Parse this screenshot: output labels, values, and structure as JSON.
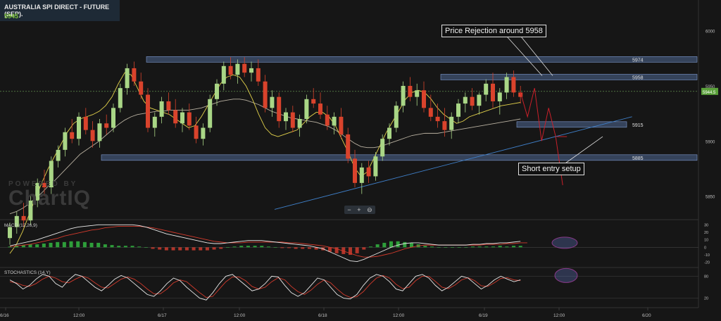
{
  "header": {
    "title": "AUSTRALIA SPI DIRECT - FUTURE (SEP).",
    "price": "5945"
  },
  "watermark": {
    "line1": "POWERED BY",
    "line2": "ChartIQ"
  },
  "zoom_controls": {
    "minus": "−",
    "plus": "+",
    "magnify": "⊖"
  },
  "callouts": {
    "rejection": "Price Rejection around 5958",
    "short": "Short entry setup"
  },
  "colors": {
    "up": "#a9d686",
    "down": "#d9432c",
    "zone": "#5a7bb0",
    "fast_ma": "#e3d24b",
    "slow_ma": "#b8b0a0",
    "trend": "#3f7fc8",
    "projection": "#c9202a",
    "highlight": "#5b6fb8"
  },
  "chart_data": [
    {
      "type": "candlestick",
      "title": "AUSTRALIA SPI DIRECT - FUTURE (SEP).",
      "last_price": 5945,
      "ylim": [
        5830,
        6010
      ],
      "y_ticks": [
        6000,
        5950,
        5900,
        5850
      ],
      "x_labels": [
        "6/16",
        "12:00",
        "6/17",
        "12:00",
        "6/18",
        "12:00",
        "6/19",
        "12:00",
        "6/20"
      ],
      "levels": [
        {
          "label": "5974",
          "value": 5974
        },
        {
          "label": "5958",
          "value": 5958
        },
        {
          "label": "5915",
          "value": 5915
        },
        {
          "label": "5885",
          "value": 5885
        }
      ],
      "current_label": "5944.5",
      "moving_average_fast": [
        5798,
        5806,
        5818,
        5833,
        5848,
        5862,
        5875,
        5886,
        5897,
        5908,
        5916,
        5920,
        5922,
        5924,
        5927,
        5932,
        5940,
        5952,
        5962,
        5960,
        5948,
        5936,
        5930,
        5928,
        5926,
        5924,
        5920,
        5916,
        5912,
        5914,
        5922,
        5932,
        5942,
        5952,
        5958,
        5960,
        5958,
        5950,
        5938,
        5924,
        5912,
        5906,
        5904,
        5906,
        5908,
        5910,
        5916,
        5922,
        5926,
        5926,
        5922,
        5914,
        5902,
        5890,
        5876,
        5868,
        5872,
        5884,
        5896,
        5908,
        5918,
        5928,
        5938,
        5944,
        5946,
        5944,
        5938,
        5930,
        5924,
        5920,
        5916,
        5918,
        5922,
        5924,
        5926,
        5928,
        5930,
        5932,
        5933,
        5934,
        5935
      ],
      "moving_average_slow": [
        5834,
        5836,
        5839,
        5843,
        5848,
        5853,
        5859,
        5864,
        5870,
        5876,
        5882,
        5888,
        5892,
        5896,
        5900,
        5905,
        5910,
        5915,
        5919,
        5922,
        5924,
        5925,
        5926,
        5927,
        5927,
        5928,
        5928,
        5928,
        5928,
        5929,
        5930,
        5932,
        5934,
        5936,
        5937,
        5938,
        5938,
        5937,
        5935,
        5933,
        5930,
        5927,
        5925,
        5923,
        5921,
        5920,
        5919,
        5918,
        5917,
        5915,
        5913,
        5910,
        5906,
        5902,
        5898,
        5895,
        5894,
        5894,
        5895,
        5897,
        5899,
        5901,
        5903,
        5905,
        5906,
        5907,
        5907,
        5907,
        5908,
        5909,
        5910,
        5911,
        5912,
        5913,
        5914,
        5915,
        5916,
        5917,
        5918,
        5919,
        5920
      ],
      "candles_ohlc": [
        [
          5812,
          5826,
          5806,
          5822
        ],
        [
          5822,
          5836,
          5816,
          5832
        ],
        [
          5832,
          5844,
          5822,
          5828
        ],
        [
          5828,
          5850,
          5824,
          5846
        ],
        [
          5846,
          5866,
          5840,
          5862
        ],
        [
          5862,
          5874,
          5850,
          5858
        ],
        [
          5858,
          5886,
          5852,
          5882
        ],
        [
          5882,
          5896,
          5876,
          5892
        ],
        [
          5892,
          5912,
          5886,
          5908
        ],
        [
          5908,
          5920,
          5898,
          5902
        ],
        [
          5902,
          5926,
          5896,
          5922
        ],
        [
          5922,
          5930,
          5906,
          5910
        ],
        [
          5910,
          5918,
          5894,
          5900
        ],
        [
          5900,
          5920,
          5894,
          5916
        ],
        [
          5916,
          5924,
          5906,
          5912
        ],
        [
          5912,
          5934,
          5908,
          5930
        ],
        [
          5930,
          5952,
          5926,
          5948
        ],
        [
          5948,
          5970,
          5942,
          5966
        ],
        [
          5966,
          5972,
          5950,
          5954
        ],
        [
          5954,
          5962,
          5938,
          5942
        ],
        [
          5942,
          5948,
          5908,
          5912
        ],
        [
          5912,
          5926,
          5904,
          5922
        ],
        [
          5922,
          5940,
          5916,
          5936
        ],
        [
          5936,
          5944,
          5924,
          5928
        ],
        [
          5928,
          5938,
          5912,
          5916
        ],
        [
          5916,
          5930,
          5908,
          5926
        ],
        [
          5926,
          5934,
          5910,
          5914
        ],
        [
          5914,
          5922,
          5898,
          5902
        ],
        [
          5902,
          5916,
          5896,
          5912
        ],
        [
          5912,
          5942,
          5908,
          5938
        ],
        [
          5938,
          5956,
          5932,
          5952
        ],
        [
          5952,
          5972,
          5946,
          5968
        ],
        [
          5968,
          5976,
          5956,
          5960
        ],
        [
          5960,
          5974,
          5952,
          5970
        ],
        [
          5970,
          5976,
          5958,
          5962
        ],
        [
          5962,
          5972,
          5954,
          5966
        ],
        [
          5966,
          5974,
          5950,
          5954
        ],
        [
          5954,
          5960,
          5926,
          5930
        ],
        [
          5930,
          5946,
          5922,
          5940
        ],
        [
          5940,
          5944,
          5912,
          5918
        ],
        [
          5918,
          5930,
          5910,
          5926
        ],
        [
          5926,
          5932,
          5908,
          5912
        ],
        [
          5912,
          5924,
          5904,
          5920
        ],
        [
          5920,
          5942,
          5916,
          5938
        ],
        [
          5938,
          5948,
          5930,
          5934
        ],
        [
          5934,
          5944,
          5920,
          5924
        ],
        [
          5924,
          5932,
          5910,
          5914
        ],
        [
          5914,
          5926,
          5906,
          5922
        ],
        [
          5922,
          5930,
          5902,
          5906
        ],
        [
          5906,
          5912,
          5880,
          5884
        ],
        [
          5884,
          5892,
          5858,
          5862
        ],
        [
          5862,
          5880,
          5852,
          5876
        ],
        [
          5876,
          5882,
          5862,
          5868
        ],
        [
          5868,
          5890,
          5864,
          5886
        ],
        [
          5886,
          5906,
          5882,
          5902
        ],
        [
          5902,
          5916,
          5896,
          5912
        ],
        [
          5912,
          5936,
          5908,
          5932
        ],
        [
          5932,
          5954,
          5926,
          5950
        ],
        [
          5950,
          5958,
          5936,
          5940
        ],
        [
          5940,
          5952,
          5932,
          5946
        ],
        [
          5946,
          5954,
          5926,
          5930
        ],
        [
          5930,
          5942,
          5918,
          5922
        ],
        [
          5922,
          5934,
          5912,
          5918
        ],
        [
          5918,
          5930,
          5904,
          5910
        ],
        [
          5910,
          5926,
          5902,
          5922
        ],
        [
          5922,
          5938,
          5916,
          5934
        ],
        [
          5934,
          5944,
          5926,
          5940
        ],
        [
          5940,
          5948,
          5928,
          5932
        ],
        [
          5932,
          5944,
          5924,
          5942
        ],
        [
          5942,
          5956,
          5936,
          5952
        ],
        [
          5952,
          5962,
          5930,
          5936
        ],
        [
          5936,
          5948,
          5924,
          5944
        ],
        [
          5944,
          5962,
          5938,
          5958
        ],
        [
          5958,
          5964,
          5940,
          5944
        ],
        [
          5944,
          5950,
          5934,
          5940
        ]
      ],
      "trendline": [
        [
          20,
          5838
        ],
        [
          82,
          5922
        ]
      ],
      "projection": [
        5944,
        5922,
        5948,
        5900,
        5930,
        5904,
        5860
      ]
    },
    {
      "type": "line",
      "title": "MACD (12,26,9)",
      "ylim": [
        -25,
        35
      ],
      "y_ticks": [
        30,
        20,
        10,
        0,
        -10,
        -20
      ],
      "macd": [
        2,
        4,
        6,
        8,
        10,
        13,
        16,
        19,
        22,
        25,
        27,
        28,
        29,
        30,
        30,
        30,
        30,
        30,
        30,
        29,
        27,
        24,
        21,
        18,
        16,
        14,
        12,
        10,
        8,
        6,
        5,
        5,
        6,
        7,
        8,
        9,
        9,
        9,
        8,
        7,
        6,
        5,
        4,
        3,
        2,
        0,
        -2,
        -6,
        -10,
        -14,
        -18,
        -19,
        -16,
        -12,
        -8,
        -4,
        0,
        3,
        5,
        6,
        6,
        5,
        4,
        3,
        3,
        3,
        3,
        3,
        4,
        4,
        5,
        5,
        6,
        6,
        7,
        8
      ],
      "signal": [
        1,
        2,
        3,
        4,
        6,
        8,
        10,
        12,
        15,
        17,
        19,
        21,
        23,
        24,
        26,
        27,
        28,
        28,
        28,
        28,
        27,
        26,
        24,
        22,
        20,
        18,
        16,
        14,
        12,
        10,
        8,
        7,
        6,
        6,
        6,
        7,
        7,
        7,
        7,
        7,
        7,
        6,
        6,
        5,
        4,
        3,
        2,
        0,
        -2,
        -5,
        -8,
        -11,
        -13,
        -13,
        -12,
        -10,
        -8,
        -5,
        -2,
        0,
        2,
        3,
        3,
        3,
        3,
        3,
        3,
        3,
        3,
        3,
        4,
        4,
        4,
        5,
        5,
        6,
        6
      ]
    },
    {
      "type": "line",
      "title": "STOCHASTICS (14,Y)",
      "ylim": [
        0,
        100
      ],
      "y_ticks": [
        80,
        20
      ],
      "k": [
        70,
        60,
        45,
        55,
        72,
        85,
        80,
        60,
        50,
        70,
        85,
        80,
        65,
        50,
        40,
        55,
        72,
        82,
        75,
        60,
        45,
        30,
        25,
        40,
        60,
        75,
        68,
        50,
        35,
        20,
        15,
        35,
        60,
        80,
        85,
        70,
        55,
        40,
        45,
        60,
        80,
        78,
        55,
        35,
        25,
        35,
        55,
        75,
        70,
        50,
        30,
        20,
        18,
        30,
        55,
        75,
        85,
        80,
        65,
        45,
        40,
        60,
        80,
        85,
        75,
        55,
        40,
        50,
        65,
        80,
        75,
        60,
        45,
        55,
        70,
        80,
        72,
        65,
        70
      ],
      "d": [
        65,
        62,
        55,
        52,
        60,
        72,
        80,
        75,
        65,
        62,
        72,
        80,
        75,
        62,
        50,
        48,
        60,
        72,
        78,
        72,
        60,
        45,
        32,
        32,
        45,
        62,
        70,
        65,
        50,
        35,
        22,
        25,
        45,
        65,
        78,
        78,
        68,
        52,
        45,
        50,
        65,
        76,
        70,
        52,
        38,
        30,
        42,
        58,
        70,
        62,
        45,
        30,
        22,
        24,
        38,
        58,
        75,
        82,
        75,
        58,
        46,
        50,
        68,
        80,
        80,
        66,
        50,
        46,
        56,
        70,
        76,
        68,
        54,
        52,
        62,
        74,
        76,
        70,
        68
      ]
    }
  ]
}
